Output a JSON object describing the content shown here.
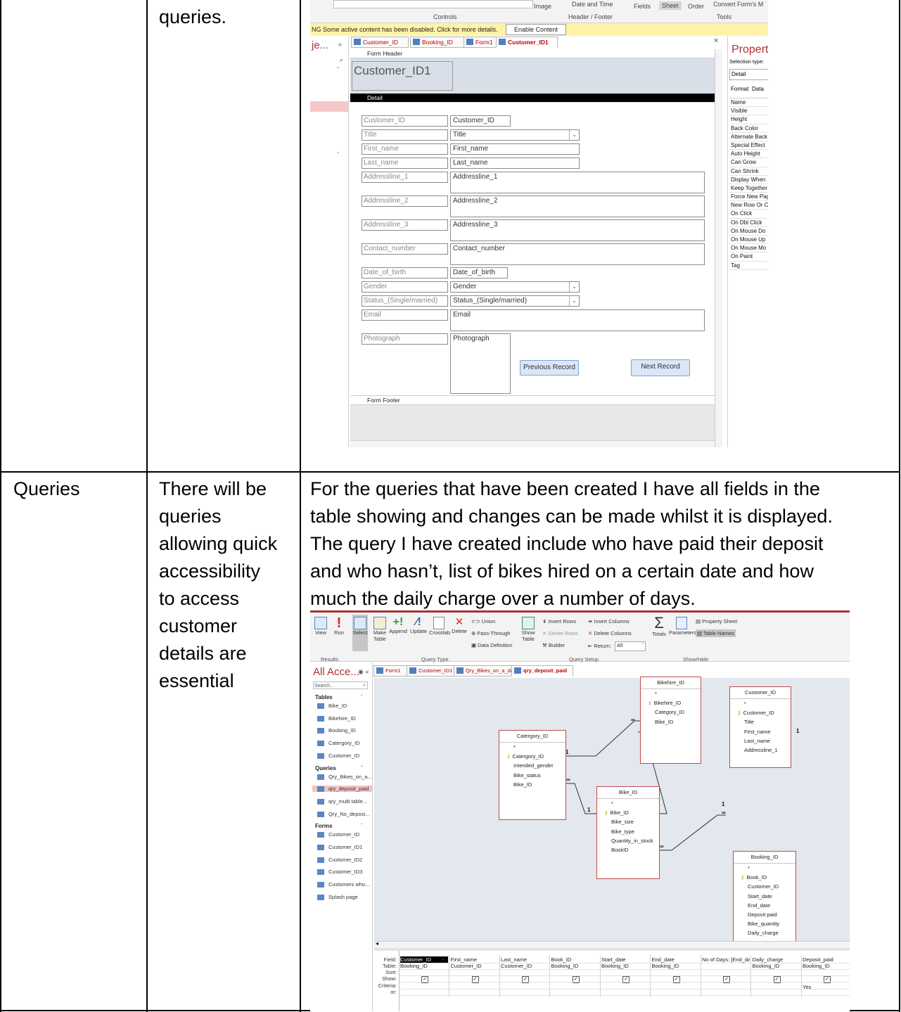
{
  "row1": {
    "col2_text": "queries.",
    "screenshot": {
      "ribbon": {
        "image_label": "Image",
        "date_time_label": "Date and Time",
        "fields_label": "Fields",
        "sheet_label": "Sheet",
        "order_label": "Order",
        "convert_label": "Convert Form's M",
        "group_controls": "Controls",
        "group_header_footer": "Header / Footer",
        "group_tools": "Tools"
      },
      "warning": {
        "text": "NG  Some active content has been disabled. Click for more details.",
        "button": "Enable Content"
      },
      "nav_pane_title": "je...",
      "tabs": [
        "Customer_ID",
        "Booking_ID",
        "Form1",
        "Customer_ID1"
      ],
      "form_header_label": "Form Header",
      "form_title": "Customer_ID1",
      "detail_label": "Detail",
      "form_footer_label": "Form Footer",
      "fields": [
        {
          "label": "Customer_ID",
          "value": "Customer_ID",
          "kind": "text"
        },
        {
          "label": "Title",
          "value": "Title",
          "kind": "combo"
        },
        {
          "label": "First_name",
          "value": "First_name",
          "kind": "text"
        },
        {
          "label": "Last_name",
          "value": "Last_name",
          "kind": "text"
        },
        {
          "label": "Addressline_1",
          "value": "Addressline_1",
          "kind": "memo"
        },
        {
          "label": "Addressline_2",
          "value": "Addressline_2",
          "kind": "memo"
        },
        {
          "label": "Addressline_3",
          "value": "Addressline_3",
          "kind": "memo"
        },
        {
          "label": "Contact_number",
          "value": "Contact_number",
          "kind": "memo"
        },
        {
          "label": "Date_of_birth",
          "value": "Date_of_birth",
          "kind": "text"
        },
        {
          "label": "Gender",
          "value": "Gender",
          "kind": "combo"
        },
        {
          "label": "Status_(Single/married)",
          "value": "Status_(Single/married)",
          "kind": "combo"
        },
        {
          "label": "Email",
          "value": "Email",
          "kind": "memo"
        },
        {
          "label": "Photograph",
          "value": "Photograph",
          "kind": "image"
        }
      ],
      "previous_button": "Previous Record",
      "next_button": "Next Record",
      "property_sheet": {
        "title": "Property",
        "selection_type_label": "Selection type:",
        "selection_value": "Detail",
        "tab_format": "Format",
        "tab_data": "Data",
        "properties": [
          "Name",
          "Visible",
          "Height",
          "Back Color",
          "Alternate Back",
          "Special Effect",
          "Auto Height",
          "Can Grow",
          "Can Shrink",
          "Display When",
          "Keep Together",
          "Force New Pag",
          "New Row Or C",
          "On Click",
          "On Dbl Click",
          "On Mouse Do",
          "On Mouse Up",
          "On Mouse Mo",
          "On Paint",
          "Tag"
        ]
      }
    }
  },
  "row2": {
    "col1_text": "Queries",
    "col2_lines": [
      "There will be",
      "queries",
      "allowing quick",
      "accessibility",
      "to access",
      "customer",
      "details are",
      "essential"
    ],
    "col3_lines": [
      "For the queries that have been created I have all fields in the",
      "table showing and changes can be made whilst it is displayed.",
      "The query I have created include who have paid their deposit",
      "and who hasn’t, list of bikes hired on a certain date and how",
      "much the daily charge over a number of days."
    ],
    "screenshot": {
      "ribbon": {
        "view": "View",
        "run": "Run",
        "select": "Select",
        "make_table": "Make Table",
        "append": "Append",
        "update": "Update",
        "crosstab": "Crosstab",
        "delete": "Delete",
        "union": "Union",
        "pass_through": "Pass-Through",
        "data_definition": "Data Definition",
        "show_table": "Show Table",
        "insert_rows": "Insert Rows",
        "delete_rows": "Delete Rows",
        "builder": "Builder",
        "insert_columns": "Insert Columns",
        "delete_columns": "Delete Columns",
        "return_label": "Return:",
        "return_value": "All",
        "totals": "Totals",
        "parameters": "Parameters",
        "property_sheet": "Property Sheet",
        "table_names": "Table Names",
        "group_results": "Results",
        "group_query_type": "Query Type",
        "group_query_setup": "Query Setup",
        "group_show_hide": "Show/Hide"
      },
      "nav_title": "All Acce...",
      "search_placeholder": "Search...",
      "nav_sections": [
        {
          "title": "Tables",
          "items": [
            "Bike_ID",
            "Bikehire_ID",
            "Booking_ID",
            "Catergory_ID",
            "Customer_ID"
          ]
        },
        {
          "title": "Queries",
          "items": [
            "Qry_Bikes_on_a...",
            "qry_deposit_paid",
            "qry_multi table...",
            "Qry_No_deposi..."
          ]
        },
        {
          "title": "Forms",
          "items": [
            "Customer_ID",
            "Customer_ID1",
            "Customer_ID2",
            "Customer_ID3",
            "Customers who...",
            "Splash page"
          ]
        }
      ],
      "tabs": [
        "Form1",
        "Customer_ID1",
        "Qry_Bikes_on_a_day",
        "qry_deposit_paid"
      ],
      "tables": [
        {
          "name": "Bikehire_ID",
          "fields": [
            "*",
            "Bikehire_ID",
            "Category_ID",
            "Bike_ID"
          ],
          "key": "Bikehire_ID"
        },
        {
          "name": "Customer_ID",
          "fields": [
            "*",
            "Customer_ID",
            "Title",
            "First_name",
            "Last_name",
            "Addressline_1"
          ],
          "key": "Customer_ID"
        },
        {
          "name": "Catergory_ID",
          "fields": [
            "*",
            "Catergory_ID",
            "Intended_gender",
            "Bike_status",
            "Bike_ID"
          ],
          "key": "Catergory_ID"
        },
        {
          "name": "Bike_ID",
          "fields": [
            "*",
            "Bike_ID",
            "Bike_size",
            "Bike_type",
            "Quantity_in_stock",
            "BookID"
          ],
          "key": "Bike_ID"
        },
        {
          "name": "Booking_ID",
          "fields": [
            "*",
            "Book_ID",
            "Customer_ID",
            "Start_date",
            "End_date",
            "Deposit paid",
            "Bike_quantity",
            "Daily_charge"
          ],
          "key": "Book_ID"
        }
      ],
      "join_one": "1",
      "join_many": "∞",
      "grid": {
        "row_labels": [
          "Field:",
          "Table:",
          "Sort:",
          "Show:",
          "Criteria:",
          "or:"
        ],
        "columns": [
          {
            "field": "Customer_ID",
            "table": "Booking_ID",
            "criteria": ""
          },
          {
            "field": "First_name",
            "table": "Customer_ID",
            "criteria": ""
          },
          {
            "field": "Last_name",
            "table": "Customer_ID",
            "criteria": ""
          },
          {
            "field": "Book_ID",
            "table": "Booking_ID",
            "criteria": ""
          },
          {
            "field": "Start_date",
            "table": "Booking_ID",
            "criteria": ""
          },
          {
            "field": "End_date",
            "table": "Booking_ID",
            "criteria": ""
          },
          {
            "field": "No of Days: [End_date",
            "table": "",
            "criteria": ""
          },
          {
            "field": "Daily_charge",
            "table": "Booking_ID",
            "criteria": ""
          },
          {
            "field": "Deposit_paid",
            "table": "Booking_ID",
            "criteria": "Yes"
          }
        ]
      }
    }
  }
}
